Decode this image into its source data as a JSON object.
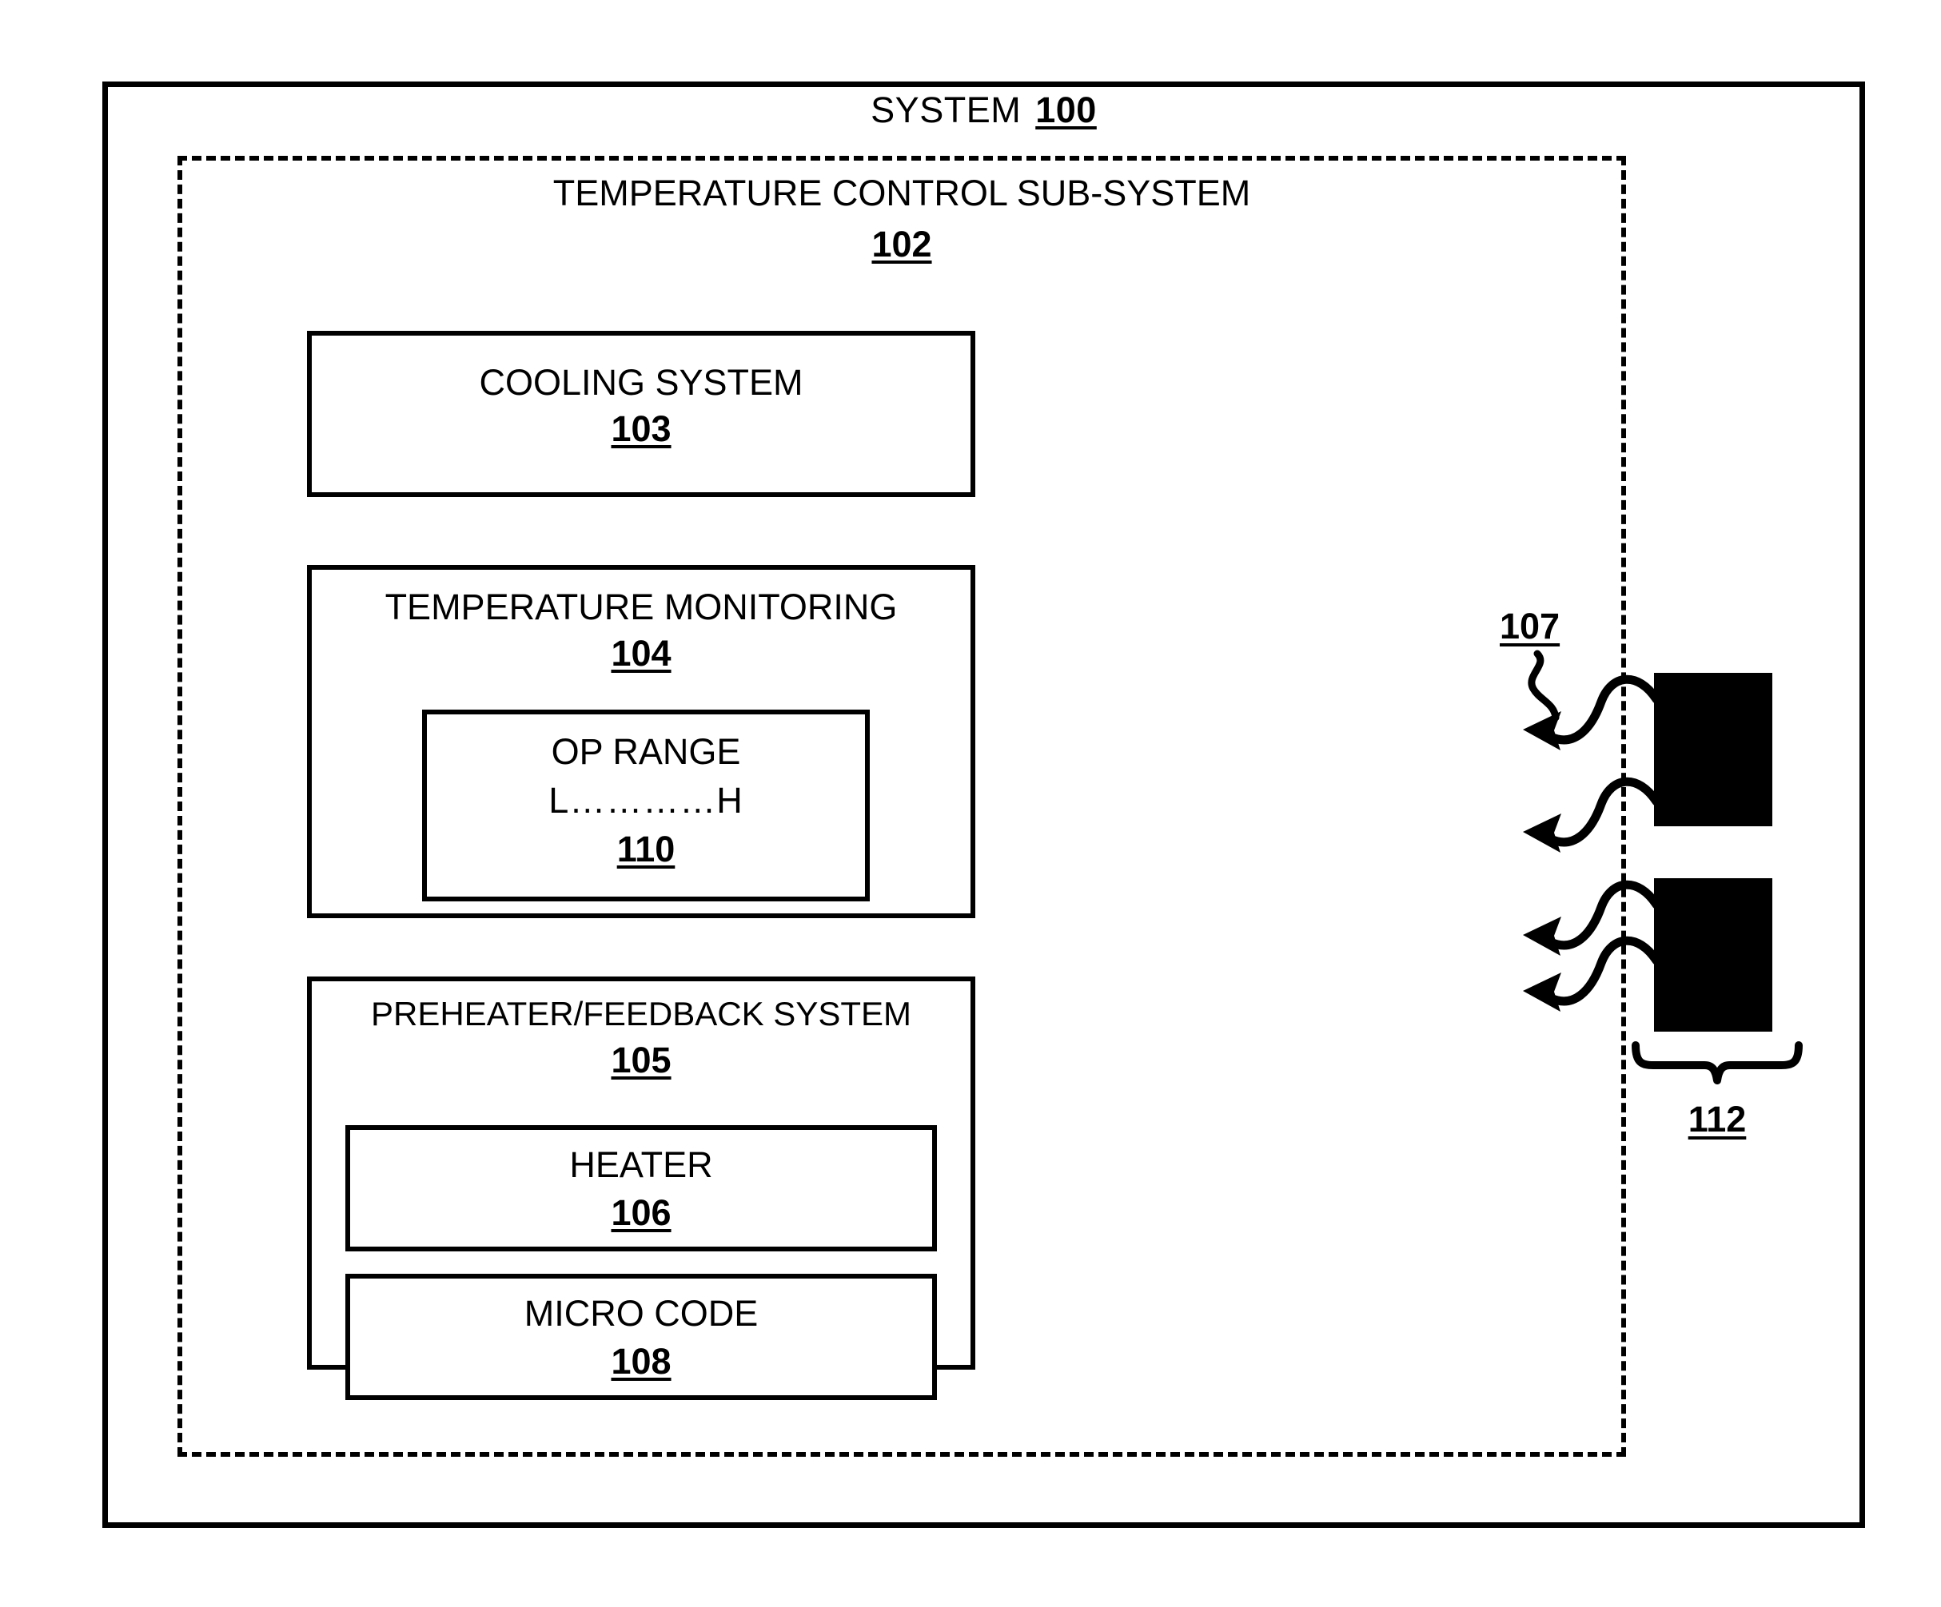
{
  "figure": {
    "system": {
      "title": "SYSTEM",
      "ref": "100"
    },
    "subsystem": {
      "title": "TEMPERATURE CONTROL SUB-SYSTEM",
      "ref": "102"
    },
    "modules": [
      {
        "key": "cooling_system",
        "label": "COOLING SYSTEM",
        "ref": "103"
      },
      {
        "key": "temperature_monitoring",
        "label": "TEMPERATURE MONITORING",
        "ref": "104"
      },
      {
        "key": "op_range",
        "label": "OP RANGE",
        "scale": "L…………H",
        "ref": "110"
      },
      {
        "key": "preheater_feedback",
        "label": "PREHEATER/FEEDBACK SYSTEM",
        "ref": "105"
      },
      {
        "key": "heater",
        "label": "HEATER",
        "ref": "106"
      },
      {
        "key": "micro_code",
        "label": "MICRO CODE",
        "ref": "108"
      }
    ],
    "callouts": {
      "heat_flow_ref": "107",
      "components_ref": "112"
    },
    "colors": {
      "line": "#000000",
      "fill": "#ffffff",
      "block": "#000000"
    }
  }
}
